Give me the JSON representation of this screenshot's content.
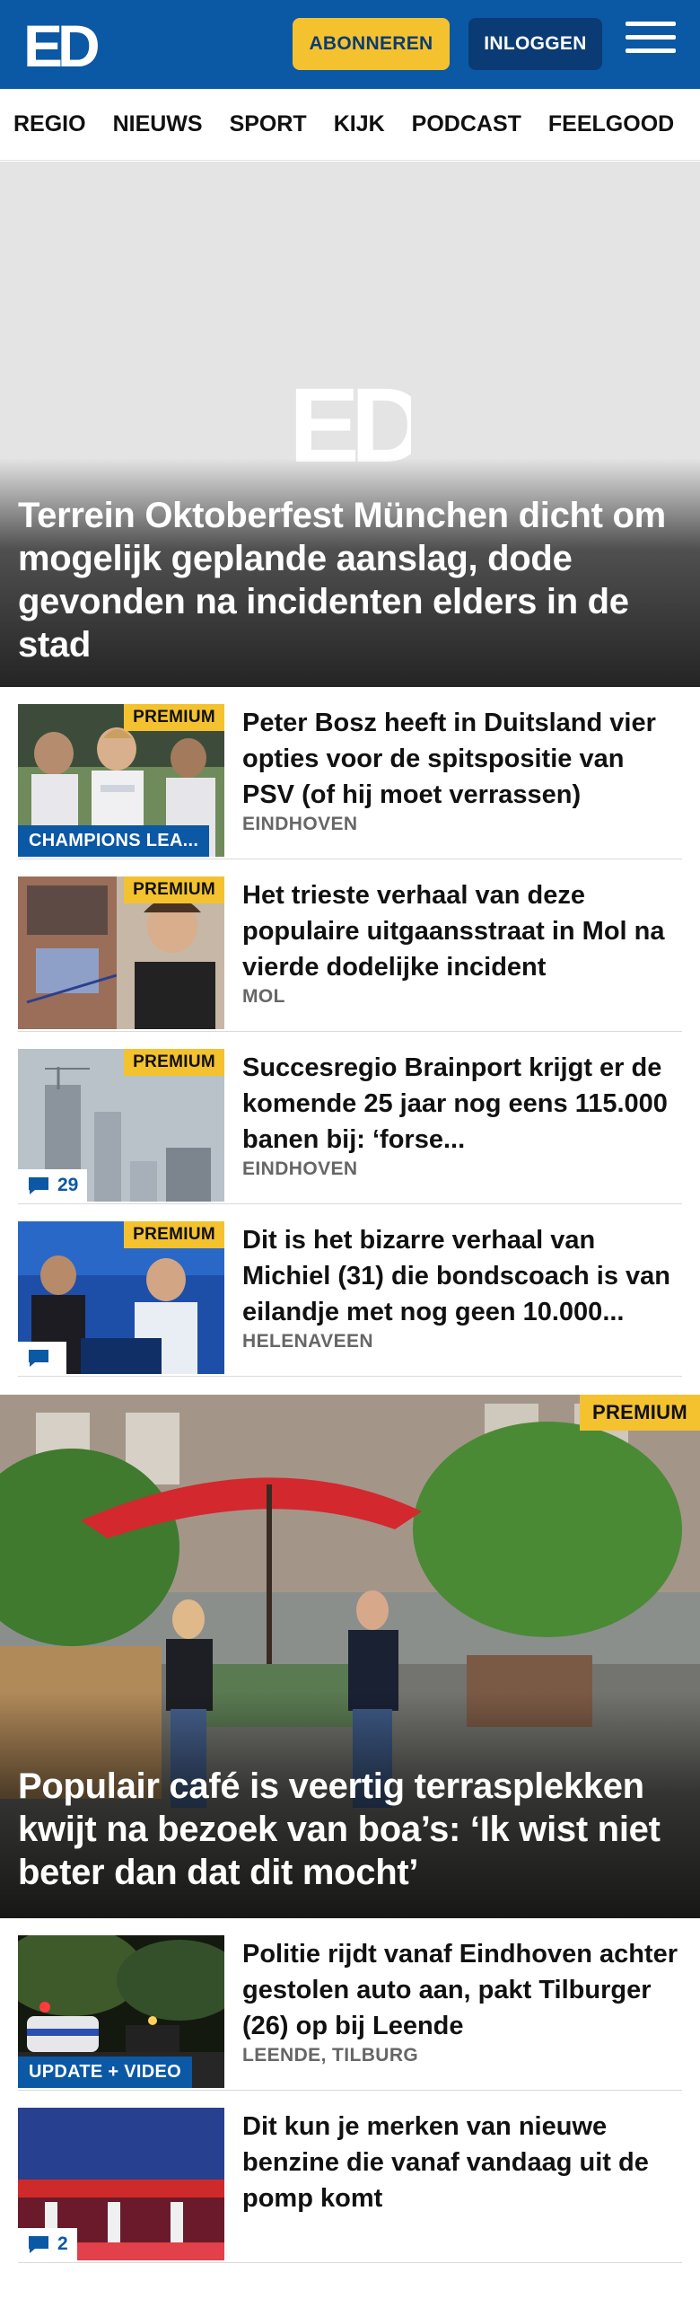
{
  "header": {
    "logo": "ED",
    "subscribe_label": "ABONNEREN",
    "login_label": "INLOGGEN",
    "brand_color": "#0b58a5",
    "accent_color": "#f4c22e"
  },
  "nav": {
    "items": [
      {
        "label": "REGIO"
      },
      {
        "label": "NIEUWS"
      },
      {
        "label": "SPORT"
      },
      {
        "label": "KIJK"
      },
      {
        "label": "PODCAST"
      },
      {
        "label": "FEELGOOD"
      }
    ]
  },
  "hero": {
    "title": "Terrein Oktoberfest München dicht om mogelijk geplande aanslag, dode gevonden na incidenten elders in de stad",
    "placeholder_logo": "ED"
  },
  "articles": [
    {
      "title": "Peter Bosz heeft in Duitsland vier opties voor de spitspositie van PSV (of hij moet verrassen)",
      "location": "EINDHOVEN",
      "premium": "PREMIUM",
      "tag": "CHAMPIONS LEA..."
    },
    {
      "title": "Het trieste verhaal van deze populaire uitgaansstraat in Mol na vierde dodelijke incident",
      "location": "MOL",
      "premium": "PREMIUM"
    },
    {
      "title": "Succesregio Brainport krijgt er de komende 25 jaar nog eens 115.000 banen bij: ‘forse...",
      "location": "EINDHOVEN",
      "premium": "PREMIUM",
      "comments": "29"
    },
    {
      "title": "Dit is het bizarre verhaal van Michiel (31) die bondscoach is van eilandje met nog geen 10.000...",
      "location": "HELENAVEEN",
      "premium": "PREMIUM",
      "comments": ""
    }
  ],
  "feature": {
    "title": "Populair café is veertig terrasplekken kwijt na bezoek van boa’s: ‘Ik wist niet beter dan dat dit mocht’",
    "premium": "PREMIUM"
  },
  "articles_bottom": [
    {
      "title": "Politie rijdt vanaf Eindhoven achter gestolen auto aan, pakt Tilburger (26) op bij Leende",
      "location": "LEENDE, TILBURG",
      "tag": "UPDATE + VIDEO"
    },
    {
      "title": "Dit kun je merken van nieuwe benzine die vanaf vandaag uit de pomp komt",
      "location": "",
      "comments": "2"
    }
  ]
}
